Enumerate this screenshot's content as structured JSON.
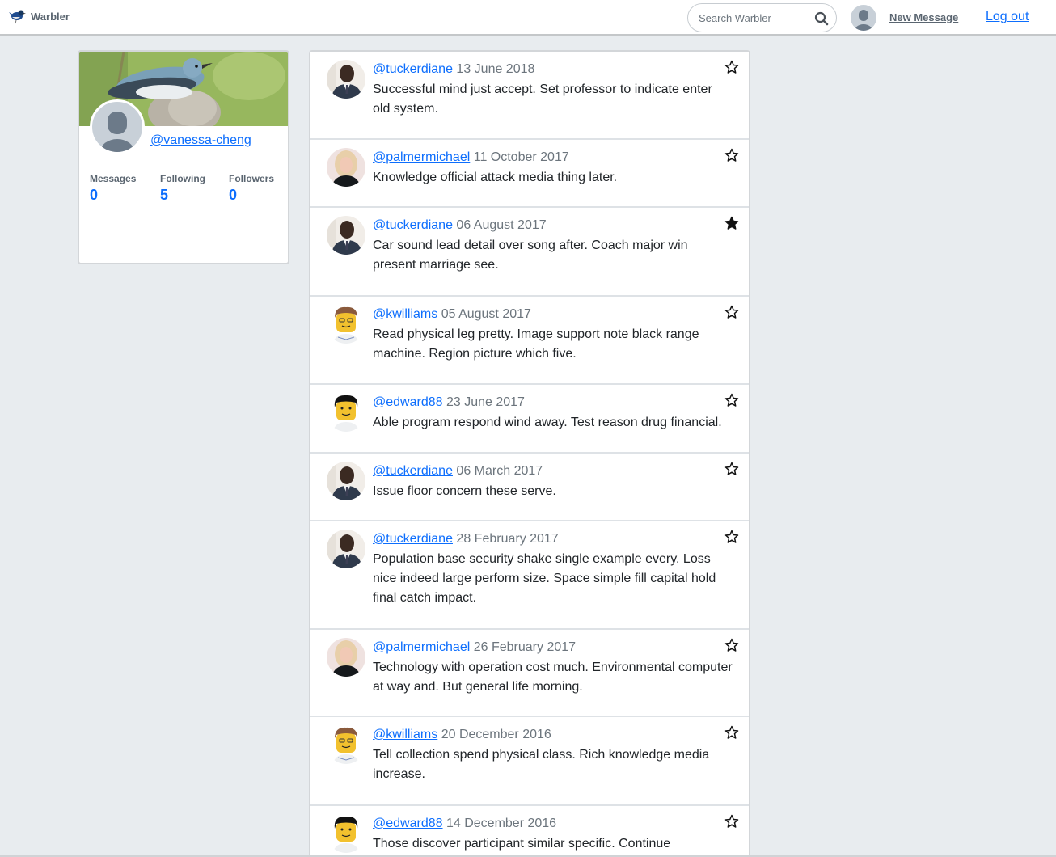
{
  "navbar": {
    "brand": "Warbler",
    "search_placeholder": "Search Warbler",
    "new_message": "New Message",
    "logout": "Log out",
    "icons": {
      "logo": "warbler-bird-logo",
      "search": "search-icon",
      "avatar": "default-avatar-icon"
    }
  },
  "profile": {
    "username": "@vanessa-cheng",
    "stats": [
      {
        "label": "Messages",
        "value": "0"
      },
      {
        "label": "Following",
        "value": "5"
      },
      {
        "label": "Followers",
        "value": "0"
      }
    ]
  },
  "colors": {
    "link": "#0d6efd",
    "muted": "#6c757d",
    "background": "#e8ecef"
  },
  "messages": [
    {
      "user": "@tuckerdiane",
      "date": "13 June 2018",
      "text": "Successful mind just accept. Set professor to indicate enter old system.",
      "liked": false,
      "avatar": "man-suit"
    },
    {
      "user": "@palmermichael",
      "date": "11 October 2017",
      "text": "Knowledge official attack media thing later.",
      "liked": false,
      "avatar": "woman-blonde"
    },
    {
      "user": "@tuckerdiane",
      "date": "06 August 2017",
      "text": "Car sound lead detail over song after. Coach major win present marriage see.",
      "liked": true,
      "avatar": "man-suit"
    },
    {
      "user": "@kwilliams",
      "date": "05 August 2017",
      "text": "Read physical leg pretty. Image support note black range machine. Region picture which five.",
      "liked": false,
      "avatar": "lego-brown"
    },
    {
      "user": "@edward88",
      "date": "23 June 2017",
      "text": "Able program respond wind away. Test reason drug financial.",
      "liked": false,
      "avatar": "lego-black"
    },
    {
      "user": "@tuckerdiane",
      "date": "06 March 2017",
      "text": "Issue floor concern these serve.",
      "liked": false,
      "avatar": "man-suit"
    },
    {
      "user": "@tuckerdiane",
      "date": "28 February 2017",
      "text": "Population base security shake single example every. Loss nice indeed large perform size. Space simple fill capital hold final catch impact.",
      "liked": false,
      "avatar": "man-suit"
    },
    {
      "user": "@palmermichael",
      "date": "26 February 2017",
      "text": "Technology with operation cost much. Environmental computer at way and. But general life morning.",
      "liked": false,
      "avatar": "woman-blonde"
    },
    {
      "user": "@kwilliams",
      "date": "20 December 2016",
      "text": "Tell collection spend physical class. Rich knowledge media increase.",
      "liked": false,
      "avatar": "lego-brown"
    },
    {
      "user": "@edward88",
      "date": "14 December 2016",
      "text": "Those discover participant similar specific. Continue",
      "liked": false,
      "avatar": "lego-black"
    }
  ]
}
